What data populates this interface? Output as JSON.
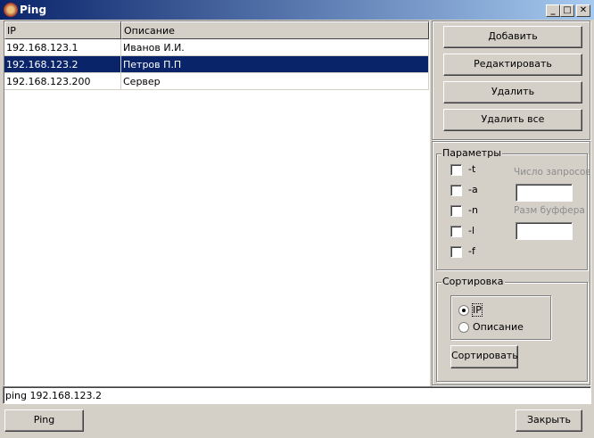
{
  "window": {
    "title": "Ping",
    "minimize": "_",
    "maximize": "□",
    "close": "✕"
  },
  "table": {
    "columns": [
      "IP",
      "Описание"
    ],
    "rows": [
      {
        "ip": "192.168.123.1",
        "desc": "Иванов И.И."
      },
      {
        "ip": "192.168.123.2",
        "desc": "Петров П.П"
      },
      {
        "ip": "192.168.123.200",
        "desc": "Сервер"
      }
    ],
    "selected_index": 1
  },
  "buttons": {
    "add": "Добавить",
    "edit": "Редактировать",
    "delete": "Удалить",
    "delete_all": "Удалить все",
    "sort": "Сортировать",
    "ping": "Ping",
    "close": "Закрыть"
  },
  "params": {
    "title": "Параметры",
    "options": [
      "-t",
      "-a",
      "-n",
      "-l",
      "-f"
    ],
    "count_label": "Число запросов",
    "count_value": "",
    "buffer_label": "Разм буффера",
    "buffer_value": ""
  },
  "sort": {
    "title": "Сортировка",
    "options": [
      "IP",
      "Описание"
    ],
    "selected": "IP"
  },
  "command": "ping 192.168.123.2"
}
